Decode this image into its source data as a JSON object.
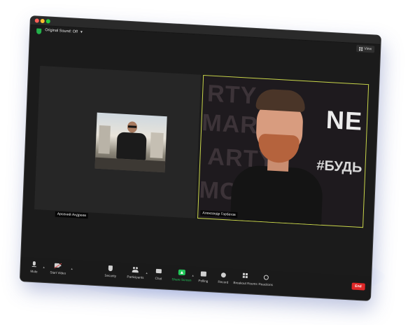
{
  "window": {
    "sound_label": "Original Sound: Off",
    "view_label": "View"
  },
  "participants": {
    "left_name": "Арсений Андреев",
    "right_name": "Александр Горбатов"
  },
  "speaker_video": {
    "backdrop_lines": [
      "RTY",
      "MART",
      "ARTY",
      "MORT"
    ],
    "brand": "NE",
    "hashtag": "#БУДЬ"
  },
  "toolbar": {
    "mute": "Mute",
    "start_video": "Start Video",
    "security": "Security",
    "participants": "Participants",
    "chat": "Chat",
    "share_screen": "Share Screen",
    "polling": "Polling",
    "record": "Record",
    "breakout_rooms": "Breakout Rooms",
    "reactions": "Reactions",
    "end": "End"
  },
  "colors": {
    "share_accent": "#23c65a",
    "end_button": "#e02828",
    "active_speaker_border": "#c9d64a",
    "secure_shield": "#24b14a"
  }
}
